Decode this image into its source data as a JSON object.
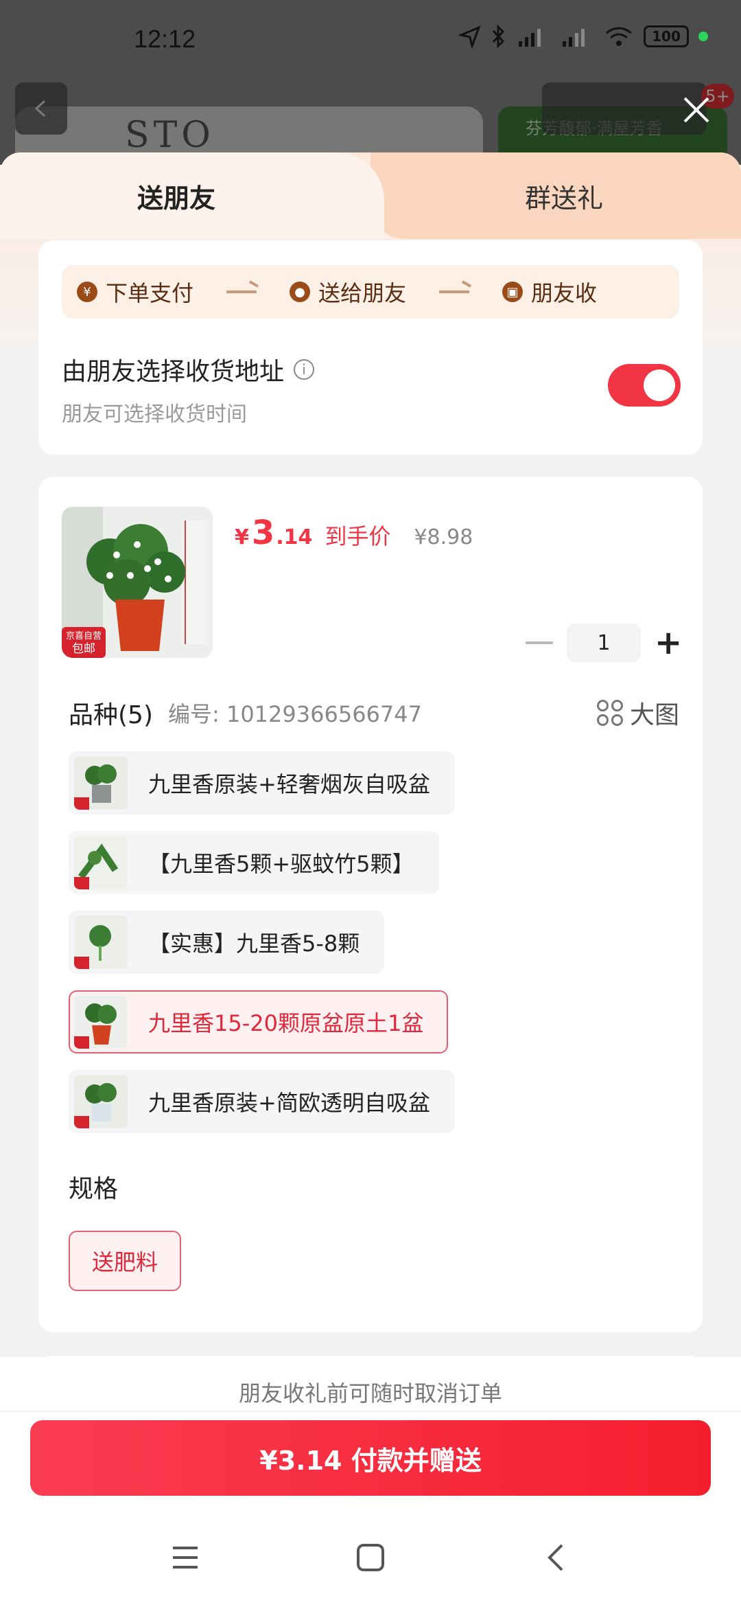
{
  "status_bar": {
    "time": "12:12",
    "battery": "100"
  },
  "background": {
    "photo_text": "STO",
    "banner_text": "芬芳馥郁·满屋芳香",
    "badge": "5+"
  },
  "tabs": [
    {
      "label": "送朋友"
    },
    {
      "label": "群送礼"
    }
  ],
  "steps": [
    {
      "icon": "¥",
      "label": "下单支付"
    },
    {
      "icon": "wechat",
      "label": "送给朋友"
    },
    {
      "icon": "gift",
      "label": "朋友收"
    }
  ],
  "address": {
    "title": "由朋友选择收货地址",
    "subtitle": "朋友可选择收货时间",
    "toggle_on": true
  },
  "product": {
    "thumb_tag1": "京喜自营",
    "thumb_tag2": "包邮",
    "price_yen": "¥",
    "price_int": "3",
    "price_dec": ".14",
    "price_label": "到手价",
    "original_price": "¥8.98",
    "quantity": "1"
  },
  "variety": {
    "title": "品种(5)",
    "code": "编号: 10129366566747",
    "big_image": "大图",
    "options": [
      {
        "label": "九里香原装+轻奢烟灰自吸盆",
        "selected": false
      },
      {
        "label": "【九里香5颗+驱蚊竹5颗】",
        "selected": false
      },
      {
        "label": "【实惠】九里香5-8颗",
        "selected": false
      },
      {
        "label": "九里香15-20颗原盆原土1盆",
        "selected": true
      },
      {
        "label": "九里香原装+简欧透明自吸盆",
        "selected": false
      }
    ]
  },
  "spec": {
    "title": "规格",
    "options": [
      {
        "label": "送肥料",
        "selected": true
      }
    ]
  },
  "footer": {
    "note": "朋友收礼前可随时取消订单",
    "pay_button": "¥3.14 付款并赠送"
  },
  "colors": {
    "accent": "#f23544",
    "selected_text": "#e0283a",
    "step_text": "#5a2d12"
  }
}
